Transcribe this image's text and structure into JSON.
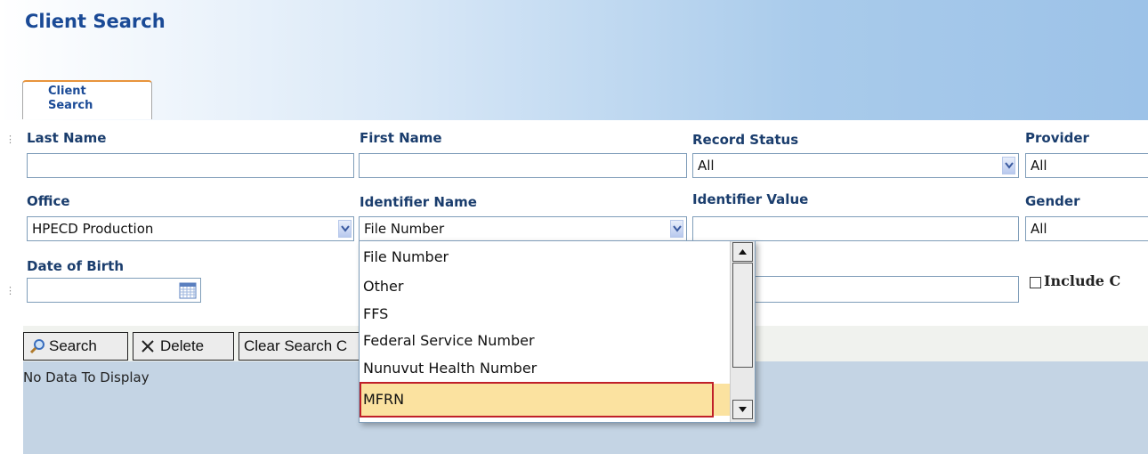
{
  "page": {
    "title": "Client Search"
  },
  "tabs": [
    {
      "label_line1": "Client",
      "label_line2": "Search"
    }
  ],
  "fields": {
    "last_name": {
      "label": "Last Name",
      "value": ""
    },
    "first_name": {
      "label": "First Name",
      "value": ""
    },
    "record_status": {
      "label": "Record Status",
      "value": "All"
    },
    "provider": {
      "label": "Provider",
      "value": "All"
    },
    "office": {
      "label": "Office",
      "value": "HPECD Production"
    },
    "identifier_name": {
      "label": "Identifier Name",
      "value": "File Number"
    },
    "identifier_value": {
      "label": "Identifier Value",
      "value": ""
    },
    "gender": {
      "label": "Gender",
      "value": "All"
    },
    "date_of_birth": {
      "label": "Date of Birth",
      "value": ""
    },
    "include_checkbox": {
      "label": "Include C",
      "checked": false
    }
  },
  "toolbar": {
    "search_label": "Search",
    "delete_label": "Delete",
    "clear_label": "Clear Search C"
  },
  "results": {
    "empty_text": "No Data To Display"
  },
  "identifier_dropdown": {
    "options": [
      "File Number",
      "Other",
      "FFS",
      "Federal Service Number",
      "Nunuvut Health Number",
      "MFRN"
    ],
    "highlighted": "MFRN"
  },
  "colors": {
    "title": "#1a4a96",
    "label": "#1a3d6d",
    "highlight_fill": "#fbe2a0",
    "highlight_border": "#c0202a",
    "tab_accent": "#e8943c"
  },
  "icons": {
    "search": "magnifier-icon",
    "delete": "x-icon",
    "calendar": "calendar-icon",
    "dropdown": "chevron-down-icon"
  }
}
